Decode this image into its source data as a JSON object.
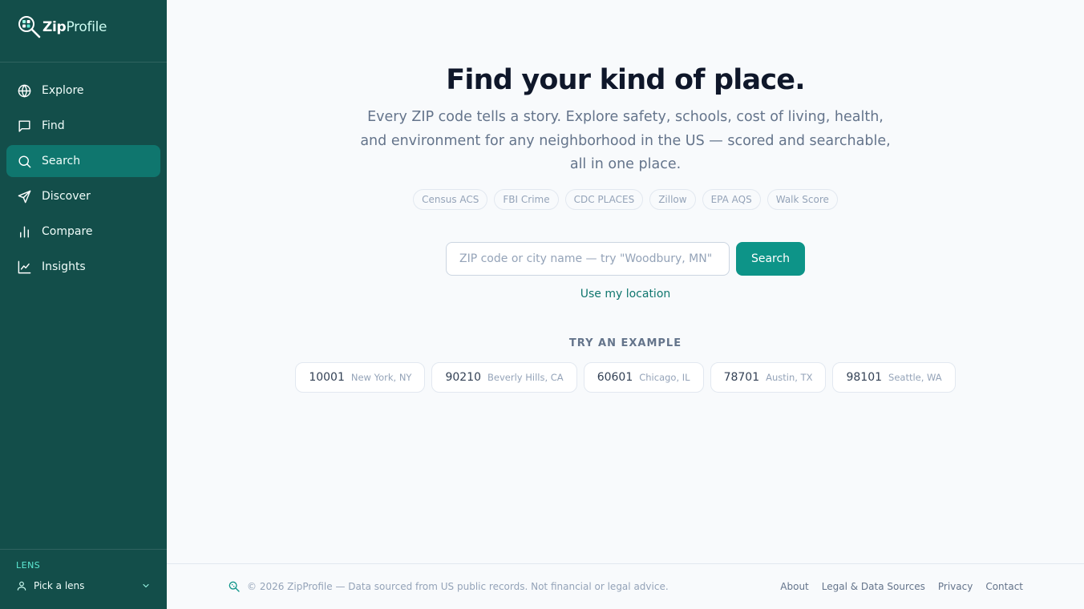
{
  "brand": {
    "name_bold": "Zip",
    "name_rest": "Profile",
    "logo_icon": "magnifier-grid-icon"
  },
  "nav": {
    "items": [
      {
        "label": "Explore",
        "icon": "globe-icon",
        "active": false
      },
      {
        "label": "Find",
        "icon": "chat-bubble-icon",
        "active": false
      },
      {
        "label": "Search",
        "icon": "search-icon",
        "active": true
      },
      {
        "label": "Discover",
        "icon": "send-icon",
        "active": false
      },
      {
        "label": "Compare",
        "icon": "bar-chart-icon",
        "active": false
      },
      {
        "label": "Insights",
        "icon": "line-chart-icon",
        "active": false
      }
    ]
  },
  "lens": {
    "title": "LENS",
    "value": "Pick a lens"
  },
  "hero": {
    "title": "Find your kind of place.",
    "subtitle": "Every ZIP code tells a story. Explore safety, schools, cost of living, health, and environment for any neighborhood in the US — scored and searchable, all in one place."
  },
  "sources": [
    "Census ACS",
    "FBI Crime",
    "CDC PLACES",
    "Zillow",
    "EPA AQS",
    "Walk Score"
  ],
  "search": {
    "placeholder": "ZIP code or city name — try \"Woodbury, MN\"",
    "value": "",
    "button_label": "Search",
    "use_location": "Use my location"
  },
  "examples": {
    "title": "TRY AN EXAMPLE",
    "items": [
      {
        "zip": "10001",
        "city": "New York, NY"
      },
      {
        "zip": "90210",
        "city": "Beverly Hills, CA"
      },
      {
        "zip": "60601",
        "city": "Chicago, IL"
      },
      {
        "zip": "78701",
        "city": "Austin, TX"
      },
      {
        "zip": "98101",
        "city": "Seattle, WA"
      }
    ]
  },
  "footer": {
    "copyright": "© 2026 ZipProfile — Data sourced from US public records. Not financial or legal advice.",
    "links": [
      "About",
      "Legal & Data Sources",
      "Privacy",
      "Contact"
    ]
  },
  "colors": {
    "sidebar": "#134e4a",
    "accent": "#0d9488",
    "active_nav": "#0f766e",
    "background": "#f8fafc"
  }
}
